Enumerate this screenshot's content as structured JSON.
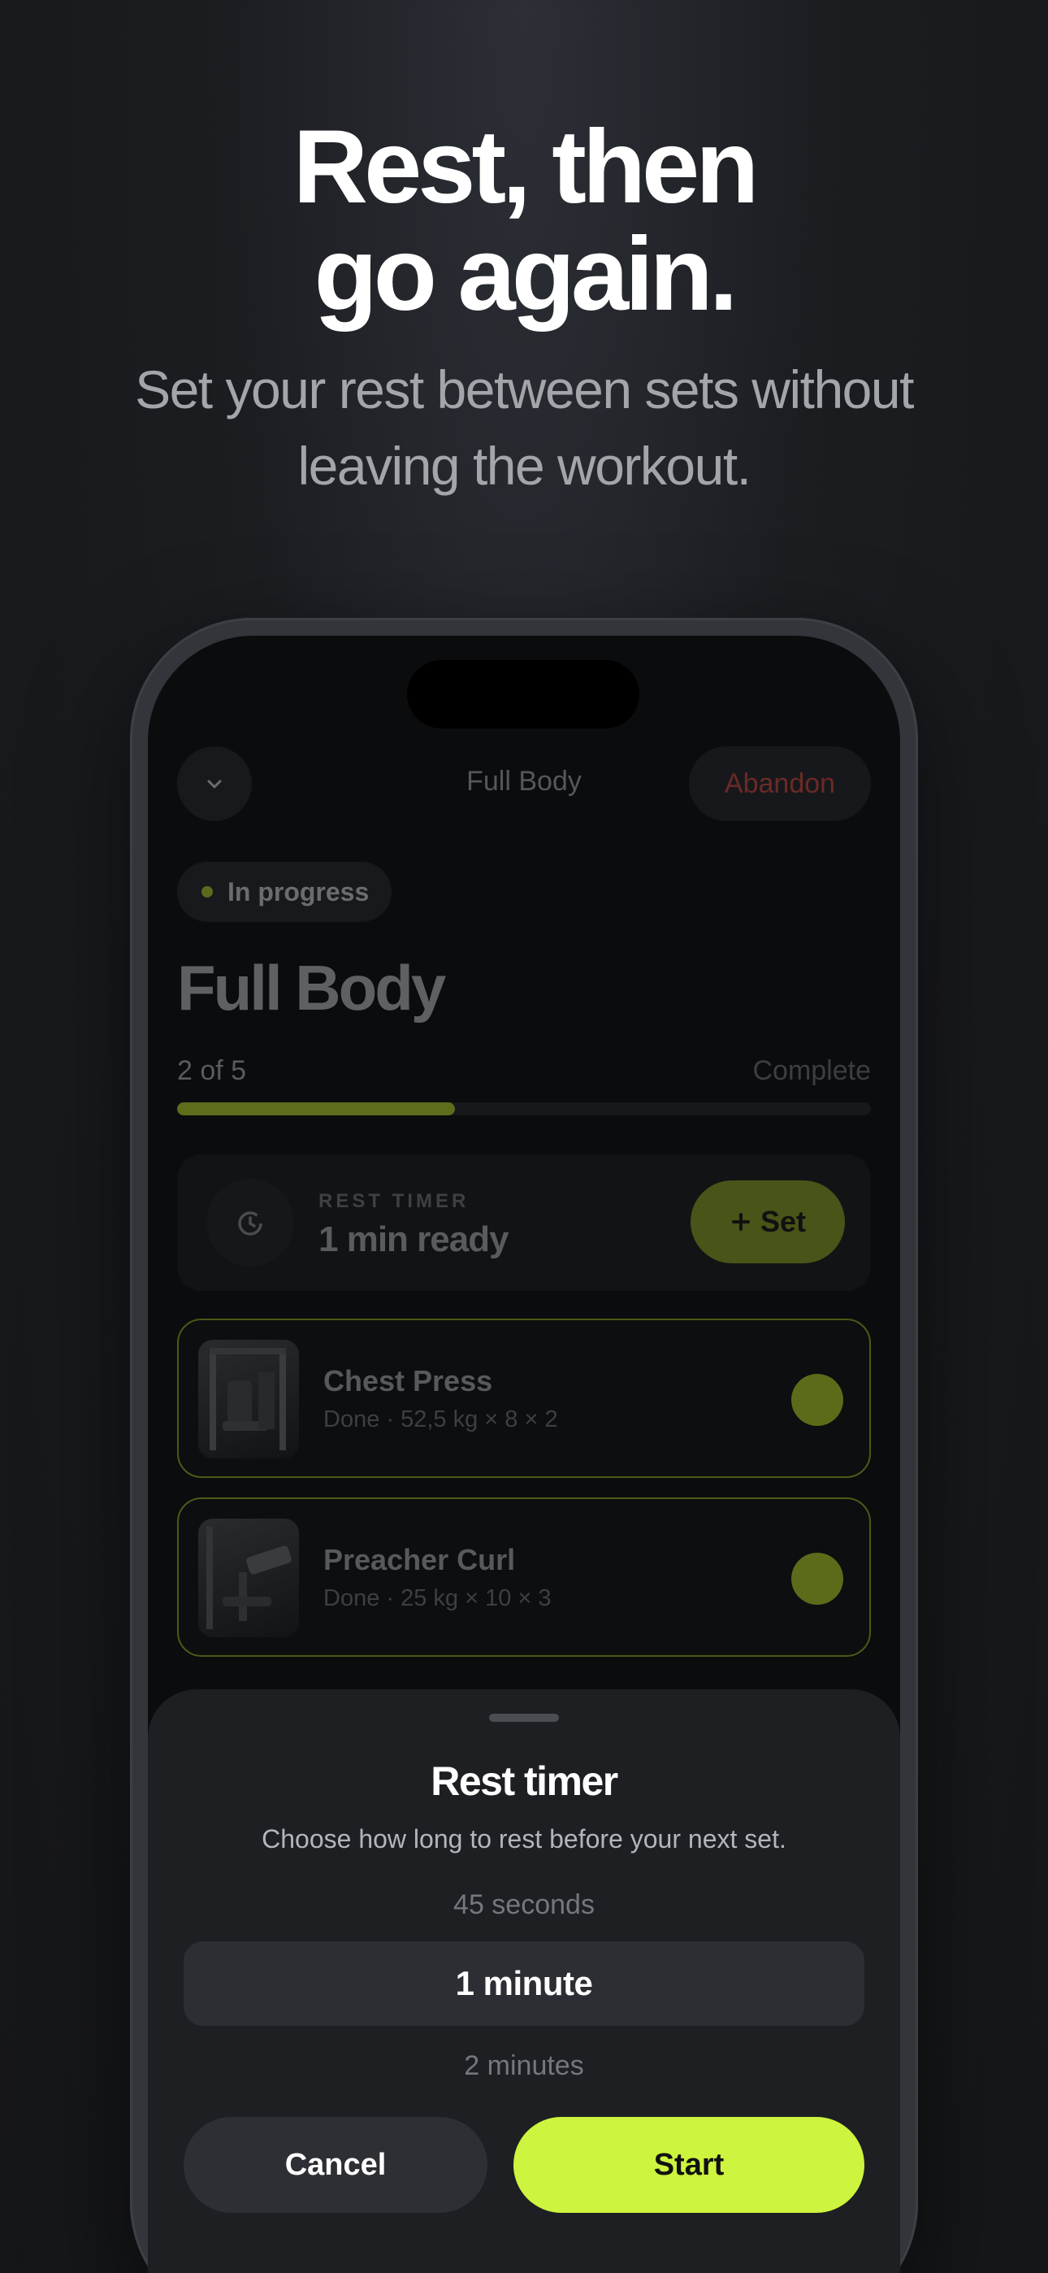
{
  "hero": {
    "headline_line1": "Rest, then",
    "headline_line2": "go again.",
    "subhead_line1": "Set your rest between sets without",
    "subhead_line2": "leaving the workout."
  },
  "nav": {
    "back_icon": "chevron-down-icon",
    "title": "Full Body",
    "abandon_label": "Abandon"
  },
  "workout": {
    "status": "In progress",
    "title": "Full Body",
    "progress_label": "2 of 5",
    "progress_right": "Complete",
    "progress_fraction": 0.4
  },
  "rest_timer_card": {
    "icon": "timer-icon",
    "kicker": "REST TIMER",
    "value": "1 min ready",
    "add_set_label": "Set",
    "add_set_icon": "plus-icon"
  },
  "exercises": [
    {
      "name": "Chest Press",
      "detail": "Done · 52,5 kg × 8 × 2"
    },
    {
      "name": "Preacher Curl",
      "detail": "Done · 25 kg × 10 × 3"
    }
  ],
  "sheet": {
    "title": "Rest timer",
    "subtitle": "Choose how long to rest before your next set.",
    "options": [
      "45 seconds",
      "1 minute",
      "2 minutes"
    ],
    "selected": "1 minute",
    "cancel_label": "Cancel",
    "start_label": "Start"
  },
  "colors": {
    "accent": "#cdf43e",
    "danger": "#d9453b",
    "sheet_bg": "#1e1f23"
  }
}
